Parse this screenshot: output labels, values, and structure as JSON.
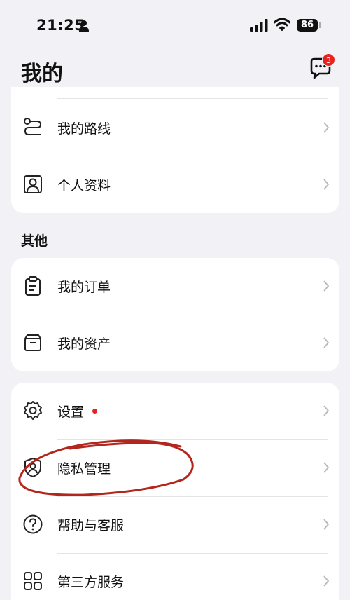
{
  "status_bar": {
    "time": "21:25",
    "battery": "86",
    "icons": [
      "person-icon",
      "signal-icon",
      "wifi-icon",
      "battery-icon"
    ]
  },
  "header": {
    "title": "我的",
    "message_badge": "3",
    "message_icon": "chat-bubble-icon"
  },
  "card_top": {
    "items": [
      {
        "label": "我的路线",
        "icon": "route-icon"
      },
      {
        "label": "个人资料",
        "icon": "profile-icon"
      }
    ]
  },
  "section_other": {
    "title": "其他",
    "items": [
      {
        "label": "我的订单",
        "icon": "clipboard-icon"
      },
      {
        "label": "我的资产",
        "icon": "box-icon"
      }
    ]
  },
  "card_settings": {
    "items": [
      {
        "label": "设置",
        "icon": "gear-icon",
        "has_dot": true
      },
      {
        "label": "隐私管理",
        "icon": "shield-person-icon"
      },
      {
        "label": "帮助与客服",
        "icon": "question-icon"
      },
      {
        "label": "第三方服务",
        "icon": "grid-icon"
      }
    ]
  },
  "colors": {
    "background": "#f2f2f6",
    "card": "#ffffff",
    "badge_red": "#e8231f",
    "annotation_red": "#b3261e",
    "chevron": "#b8b8bd"
  }
}
